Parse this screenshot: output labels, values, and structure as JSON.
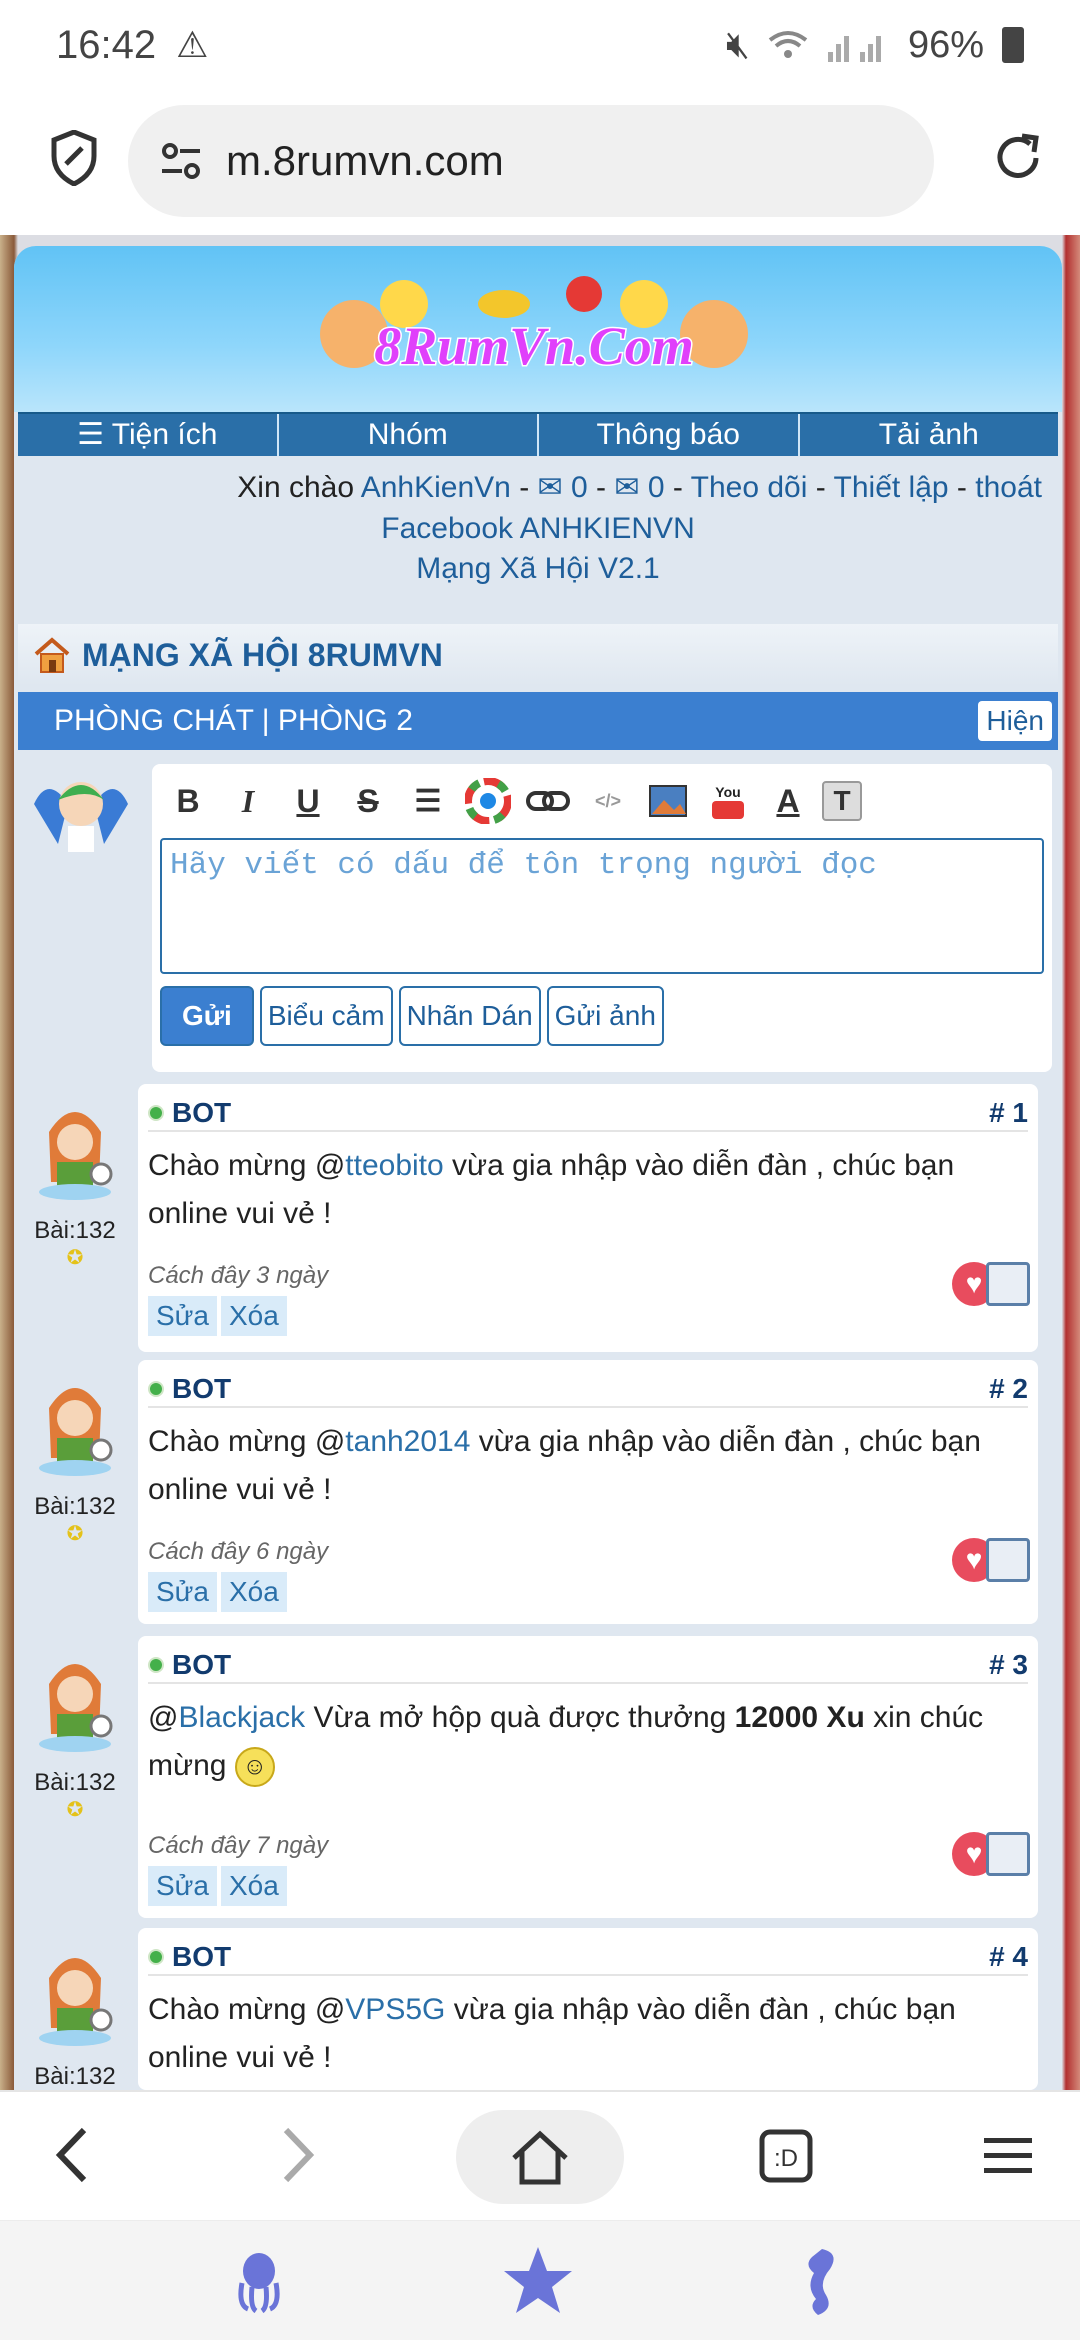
{
  "status": {
    "time": "16:42",
    "battery": "96%"
  },
  "browser": {
    "url": "m.8rumvn.com"
  },
  "nav": {
    "tabs": [
      "☰ Tiện ích",
      "Nhóm",
      "Thông báo",
      "Tải ảnh"
    ]
  },
  "greeting": {
    "prefix": "Xin chào ",
    "user": "AnhKienVn",
    "msg1": "✉ 0",
    "msg2": "✉ 0",
    "follow": "Theo dõi",
    "settings": "Thiết lập",
    "logout": "thoát",
    "sep": " - "
  },
  "facebook": "Facebook ANHKIENVN",
  "social": "Mạng Xã Hội V2.1",
  "site_title": "MẠNG XÃ HỘI 8RUMVN",
  "room": {
    "title": "PHÒNG CHÁT | PHÒNG 2",
    "toggle": "Hiện"
  },
  "compose": {
    "placeholder": "Hãy viết có dấu để tôn trọng người đọc",
    "send": "Gửi",
    "emoji": "Biểu cảm",
    "sticker": "Nhãn Dán",
    "image": "Gửi ảnh"
  },
  "posts": [
    {
      "author": "BOT",
      "num": "# 1",
      "pre": "Chào mừng @",
      "mention": "tteobito",
      "post": " vừa gia nhập vào diễn đàn , chúc bạn online vui vẻ !",
      "time": "Cách đây 3 ngày",
      "edit": "Sửa",
      "delete": "Xóa",
      "count": "Bài:132"
    },
    {
      "author": "BOT",
      "num": "# 2",
      "pre": "Chào mừng @",
      "mention": "tanh2014",
      "post": " vừa gia nhập vào diễn đàn , chúc bạn online vui vẻ !",
      "time": "Cách đây 6 ngày",
      "edit": "Sửa",
      "delete": "Xóa",
      "count": "Bài:132"
    },
    {
      "author": "BOT",
      "num": "# 3",
      "pre": "@",
      "mention": "Blackjack",
      "post": " Vừa mở hộp quà được thưởng ",
      "bold": "12000 Xu",
      "post2": " xin chúc mừng",
      "time": "Cách đây 7 ngày",
      "edit": "Sửa",
      "delete": "Xóa",
      "count": "Bài:132"
    },
    {
      "author": "BOT",
      "num": "# 4",
      "pre": "Chào mừng @",
      "mention": "VPS5G",
      "post": " vừa gia nhập vào diễn đàn , chúc bạn online vui vẻ !",
      "count": "Bài:132"
    }
  ],
  "colors": {
    "accent": "#2a6fa8",
    "header": "#3b7fd0",
    "banner": "#61c3f5",
    "heart": "#e84c5e"
  }
}
